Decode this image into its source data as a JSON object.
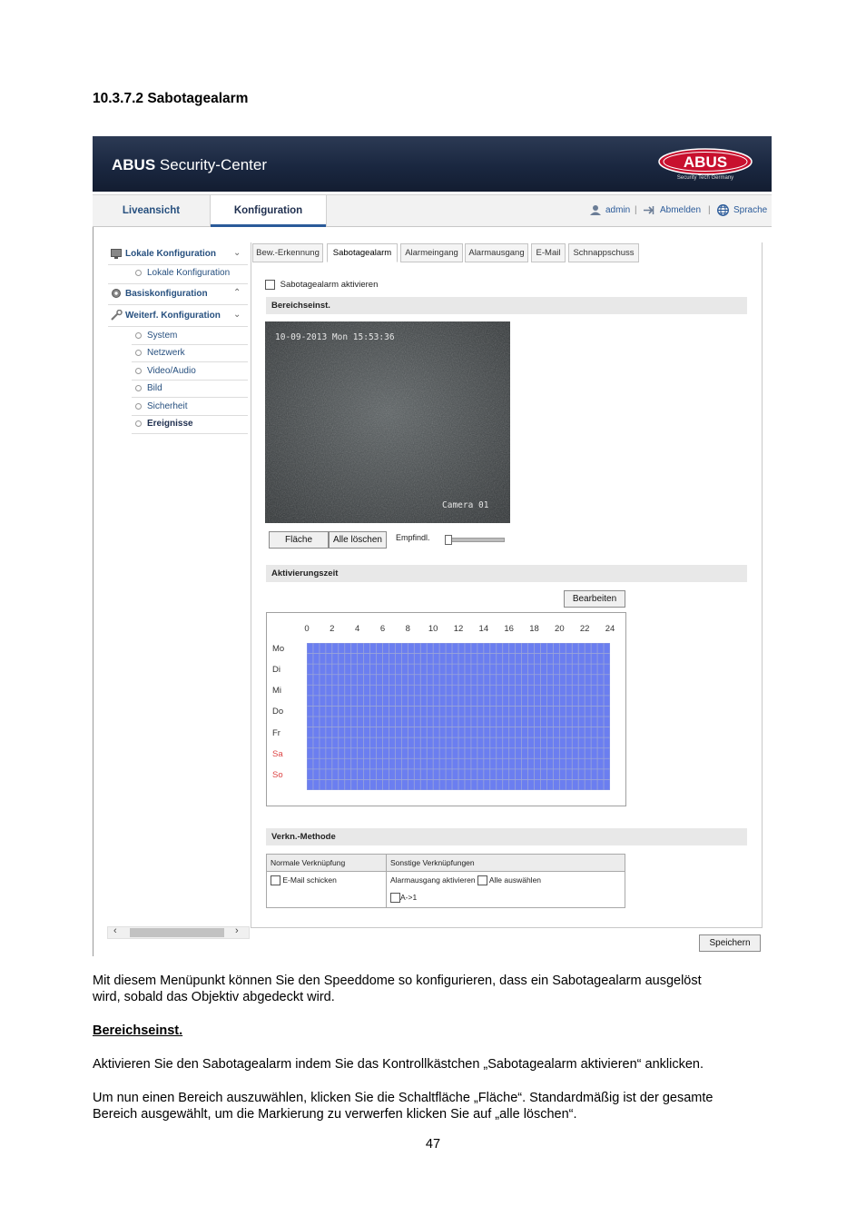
{
  "doc": {
    "heading": "10.3.7.2 Sabotagealarm",
    "para1_l1": "Mit diesem Menüpunkt können Sie den Speeddome so konfigurieren, dass ein Sabotagealarm ausgelöst",
    "para1_l2": "wird, sobald das Objektiv abgedeckt wird.",
    "subheading": "Bereichseinst.",
    "para2": "Aktivieren Sie den Sabotagealarm indem Sie das Kontrollkästchen „Sabotagealarm aktivieren“ anklicken.",
    "para3_l1": "Um nun einen Bereich auszuwählen, klicken Sie die Schaltfläche „Fläche“. Standardmäßig ist der gesamte",
    "para3_l2": "Bereich ausgewählt, um die Markierung zu verwerfen klicken Sie auf „alle löschen“.",
    "page_number": "47"
  },
  "app": {
    "brand_bold": "ABUS",
    "brand_rest": " Security-Center",
    "logo_text": "ABUS",
    "logo_sub": "Security Tech Germany",
    "nav": {
      "live": "Liveansicht",
      "config": "Konfiguration"
    },
    "user": {
      "name": "admin",
      "logout": "Abmelden",
      "language": "Sprache"
    }
  },
  "menu": {
    "local": "Lokale Konfiguration",
    "local_sub": "Lokale Konfiguration",
    "basic": "Basiskonfiguration",
    "advanced": "Weiterf. Konfiguration",
    "items": [
      "System",
      "Netzwerk",
      "Video/Audio",
      "Bild",
      "Sicherheit",
      "Ereignisse"
    ],
    "active_item": "Ereignisse"
  },
  "tabs": [
    "Bew.-Erkennung",
    "Sabotagealarm",
    "Alarmeingang",
    "Alarmausgang",
    "E-Mail",
    "Schnappschuss"
  ],
  "active_tab": "Sabotagealarm",
  "form": {
    "enable_label": "Sabotagealarm aktivieren",
    "enable_checked": false,
    "area_header": "Bereichseinst.",
    "osd_datetime": "10-09-2013 Mon 15:53:36",
    "osd_camera": "Camera 01",
    "btn_area": "Fläche",
    "btn_clear": "Alle löschen",
    "sensitivity_label": "Empfindl.",
    "sensitivity_level": 0,
    "schedule_header": "Aktivierungszeit",
    "btn_edit": "Bearbeiten",
    "hours": [
      "0",
      "2",
      "4",
      "6",
      "8",
      "10",
      "12",
      "14",
      "16",
      "18",
      "20",
      "22",
      "24"
    ],
    "days": [
      "Mo",
      "Di",
      "Mi",
      "Do",
      "Fr",
      "Sa",
      "So"
    ],
    "weekend_color": "#dd4444",
    "schedule_color": "#6b7ef0",
    "link_header": "Verkn.-Methode",
    "link_col1": "Normale Verknüpfung",
    "link_col2": "Sonstige Verknüpfungen",
    "email_label": "E-Mail schicken",
    "alarm_out_label": "Alarmausgang aktivieren",
    "select_all_label": "Alle auswählen",
    "output_label": "A->1",
    "save": "Speichern"
  }
}
